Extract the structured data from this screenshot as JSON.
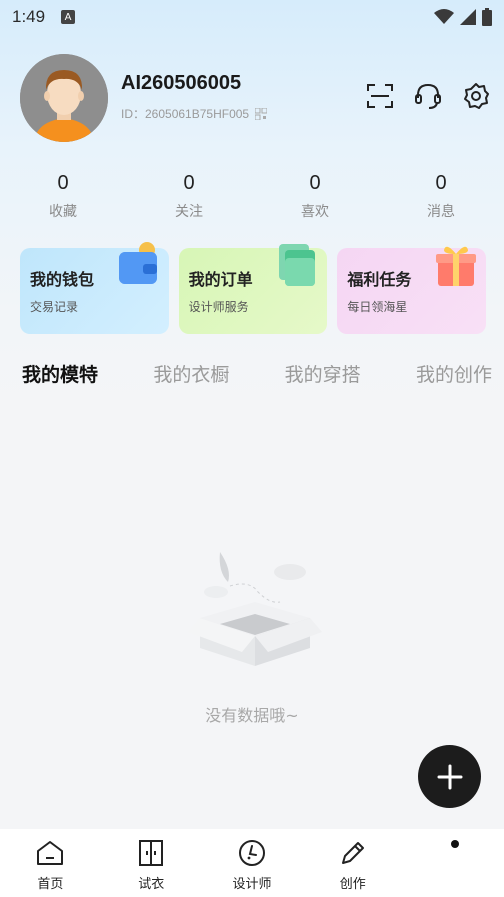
{
  "status": {
    "time": "1:49",
    "notif": "A"
  },
  "profile": {
    "name": "AI260506005",
    "id_text": "ID：2605061B75HF005"
  },
  "icons": {
    "scan": "scan-icon",
    "service": "headset-icon",
    "settings": "gear-icon"
  },
  "stats": [
    {
      "num": "0",
      "label": "收藏"
    },
    {
      "num": "0",
      "label": "关注"
    },
    {
      "num": "0",
      "label": "喜欢"
    },
    {
      "num": "0",
      "label": "消息"
    }
  ],
  "cards": [
    {
      "title": "我的钱包",
      "sub": "交易记录"
    },
    {
      "title": "我的订单",
      "sub": "设计师服务"
    },
    {
      "title": "福利任务",
      "sub": "每日领海星"
    }
  ],
  "tabs": [
    "我的模特",
    "我的衣橱",
    "我的穿搭",
    "我的创作"
  ],
  "empty_text": "没有数据哦~",
  "nav": [
    {
      "label": "首页",
      "icon": "home-icon"
    },
    {
      "label": "试衣",
      "icon": "wardrobe-icon"
    },
    {
      "label": "设计师",
      "icon": "designer-icon"
    },
    {
      "label": "创作",
      "icon": "pen-icon"
    },
    {
      "label": "",
      "icon": "profile-icon"
    }
  ],
  "colors": {
    "fab": "#1c1c1c",
    "accent_text": "#111111"
  }
}
